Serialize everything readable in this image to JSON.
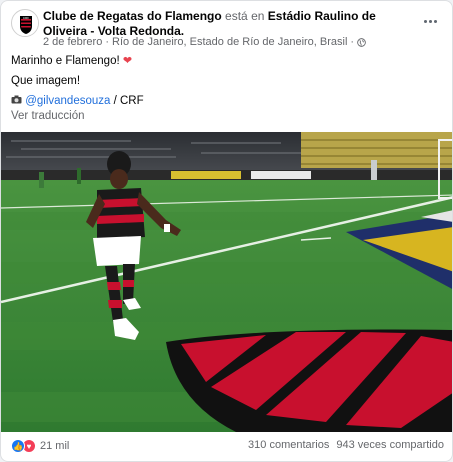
{
  "post": {
    "page_name": "Clube de Regatas do Flamengo",
    "at_text": "está en",
    "location": "Estádio Raulino de Oliveira - Volta Redonda.",
    "date": "2 de febrero",
    "place": "Río de Janeiro, Estado de Río de Janeiro, Brasil",
    "privacy_icon": "globe-icon",
    "line1": "Marinho e Flamengo!",
    "line2": "Que imagem!",
    "credit_icon": "camera-icon",
    "credit_handle": "@gilvandesouza",
    "credit_rest": " / CRF",
    "translate": "Ver traducción"
  },
  "footer": {
    "reactions_count": "21 mil",
    "comments": "310 comentarios",
    "shares": "943 veces compartido"
  },
  "colors": {
    "link": "#216fdb",
    "flamengo_red": "#c8102e",
    "pitch_green": "#3d8a3a"
  }
}
